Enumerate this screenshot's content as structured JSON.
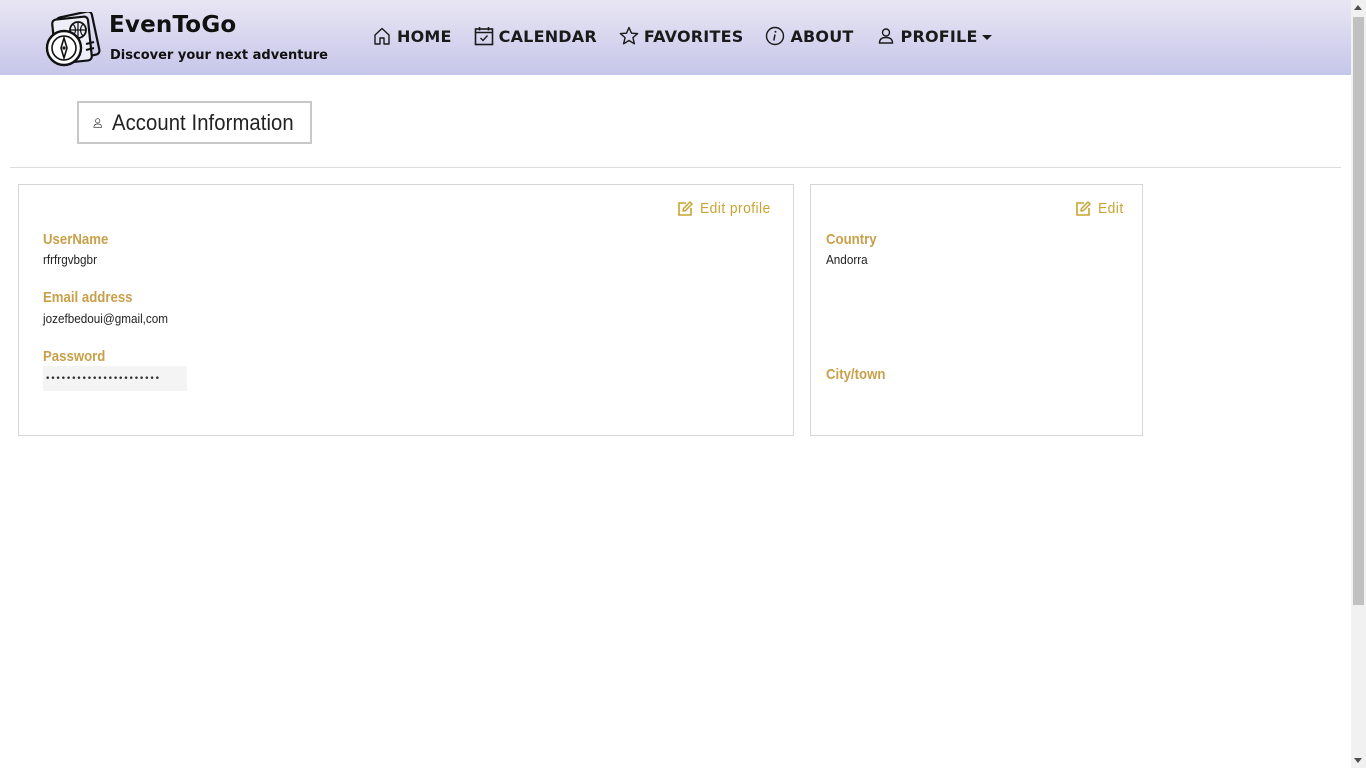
{
  "brand": {
    "title": "EvenToGo",
    "tagline": "Discover your next adventure"
  },
  "nav": [
    {
      "label": "HOME",
      "icon": "home-icon"
    },
    {
      "label": "CALENDAR",
      "icon": "calendar-icon"
    },
    {
      "label": "FAVORITES",
      "icon": "star-icon"
    },
    {
      "label": "ABOUT",
      "icon": "info-icon"
    },
    {
      "label": "PROFILE",
      "icon": "user-icon"
    }
  ],
  "header": {
    "title": "Account Information"
  },
  "account_card": {
    "edit_label": "Edit profile",
    "username_label": "UserName",
    "username_value": "rfrfrgvbgbr",
    "email_label": "Email address",
    "email_value": "jozefbedoui@gmail,com",
    "password_label": "Password",
    "password_value": "••••••••••••••••••••••"
  },
  "location_card": {
    "edit_label": "Edit",
    "country_label": "Country",
    "country_value": "Andorra",
    "city_label": "City/town"
  },
  "colors": {
    "accent": "#c9a431",
    "nav_gradient_top": "#e9e6f3",
    "nav_gradient_bottom": "#c6c6ea"
  }
}
